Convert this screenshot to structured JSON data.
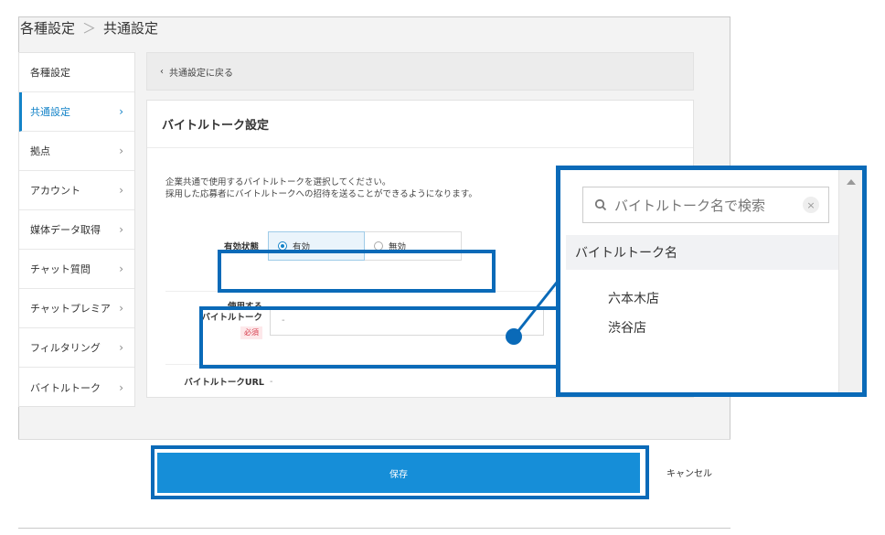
{
  "breadcrumb": {
    "parent": "各種設定",
    "separator": "＞",
    "current": "共通設定"
  },
  "sidebar": {
    "header": "各種設定",
    "items": [
      {
        "label": "共通設定"
      },
      {
        "label": "拠点"
      },
      {
        "label": "アカウント"
      },
      {
        "label": "媒体データ取得"
      },
      {
        "label": "チャット質問"
      },
      {
        "label": "チャットプレミア"
      },
      {
        "label": "フィルタリング"
      },
      {
        "label": "バイトルトーク"
      }
    ]
  },
  "back_link": "共通設定に戻る",
  "panel": {
    "title": "バイトルトーク設定",
    "desc_line1": "企業共通で使用するバイトルトークを選択してください。",
    "desc_line2": "採用した応募者にバイトルトークへの招待を送ることができるようになります。",
    "status_label": "有効状態",
    "status_options": [
      "有効",
      "無効"
    ],
    "status_selected": "有効",
    "talk_label_1": "使用する",
    "talk_label_2": "バイトルトーク",
    "required_badge": "必須",
    "talk_value": "-",
    "url_label": "バイトルトークURL",
    "url_value": "-"
  },
  "footer": {
    "save": "保存",
    "cancel": "キャンセル"
  },
  "popup": {
    "search_placeholder": "バイトルトーク名で検索",
    "list_header": "バイトルトーク名",
    "options": [
      "六本木店",
      "渋谷店"
    ]
  },
  "colors": {
    "accent": "#1383c8",
    "highlight": "#0a6ab8",
    "save_button": "#168ed8"
  }
}
